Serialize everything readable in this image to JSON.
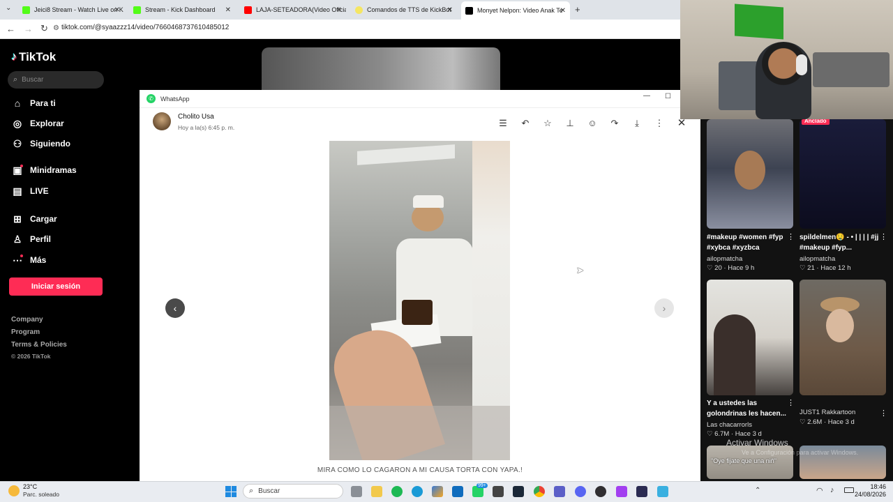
{
  "browser": {
    "tabs": [
      {
        "label": "Jeici8 Stream - Watch Live on K",
        "color": "#53fc18"
      },
      {
        "label": "Stream - Kick Dashboard",
        "color": "#53fc18"
      },
      {
        "label": "LAJA-SETEADORA(Video Oficial",
        "color": "#ff0000"
      },
      {
        "label": "Comandos de TTS de KickBot",
        "color": "#f5e663"
      },
      {
        "label": "Monyet Nelpon: Video Anak Te",
        "color": "#000000"
      }
    ],
    "url": "tiktok.com/@syaazzz14/video/7660468737610485012"
  },
  "tiktok": {
    "logo": "TikTok",
    "search_placeholder": "Buscar",
    "nav": [
      {
        "label": "Para ti",
        "icon": "home-icon"
      },
      {
        "label": "Explorar",
        "icon": "compass-icon"
      },
      {
        "label": "Siguiendo",
        "icon": "following-icon"
      },
      {
        "label": "Minidramas",
        "icon": "minidrama-icon"
      },
      {
        "label": "LIVE",
        "icon": "live-icon"
      },
      {
        "label": "Cargar",
        "icon": "upload-icon"
      },
      {
        "label": "Perfil",
        "icon": "profile-icon"
      },
      {
        "label": "Más",
        "icon": "more-icon"
      }
    ],
    "login_button": "Iniciar sesión",
    "footer": [
      "Company",
      "Program",
      "Terms & Policies",
      "© 2026 TikTok"
    ],
    "accent": "#fe2c55"
  },
  "whatsapp": {
    "window_title": "WhatsApp",
    "sender": "Cholito Usa",
    "timestamp": "Hoy a la(s) 6:45 p. m.",
    "caption": "MIRA COMO LO CAGARON A MI CAUSA TORTA CON YAPA.!",
    "prev_glyph": "‹",
    "next_glyph": "›"
  },
  "feed": {
    "pinned_badge": "Anclado",
    "cards": [
      {
        "title": "#makeup #women #fyp #xybca #xyzbca",
        "author": "ailopmatcha",
        "likes": "20",
        "time": "Hace 9 h"
      },
      {
        "title": "spildelmen🤤 - • | | | | #jj #makeup #fyp...",
        "author": "ailopmatcha",
        "likes": "21",
        "time": "Hace 12 h"
      },
      {
        "title": "Y a ustedes las golondrinas les hacen...",
        "author": "Las chacarrorls",
        "likes": "6.7M",
        "time": "Hace 3 d"
      },
      {
        "title": "",
        "author": "JUST1 Rakkartoon",
        "likes": "2.6M",
        "time": "Hace 3 d"
      }
    ],
    "thumb_text": "\"Oye fijate que una niñ\""
  },
  "watermark": {
    "line1": "Activar Windows",
    "line2": "Ve a Configuración para activar Windows."
  },
  "taskbar": {
    "weather_temp": "23°C",
    "weather_desc": "Parc. soleado",
    "search_placeholder": "Buscar",
    "time": "18:46",
    "date": "24/08/2026",
    "badge": "99+"
  }
}
